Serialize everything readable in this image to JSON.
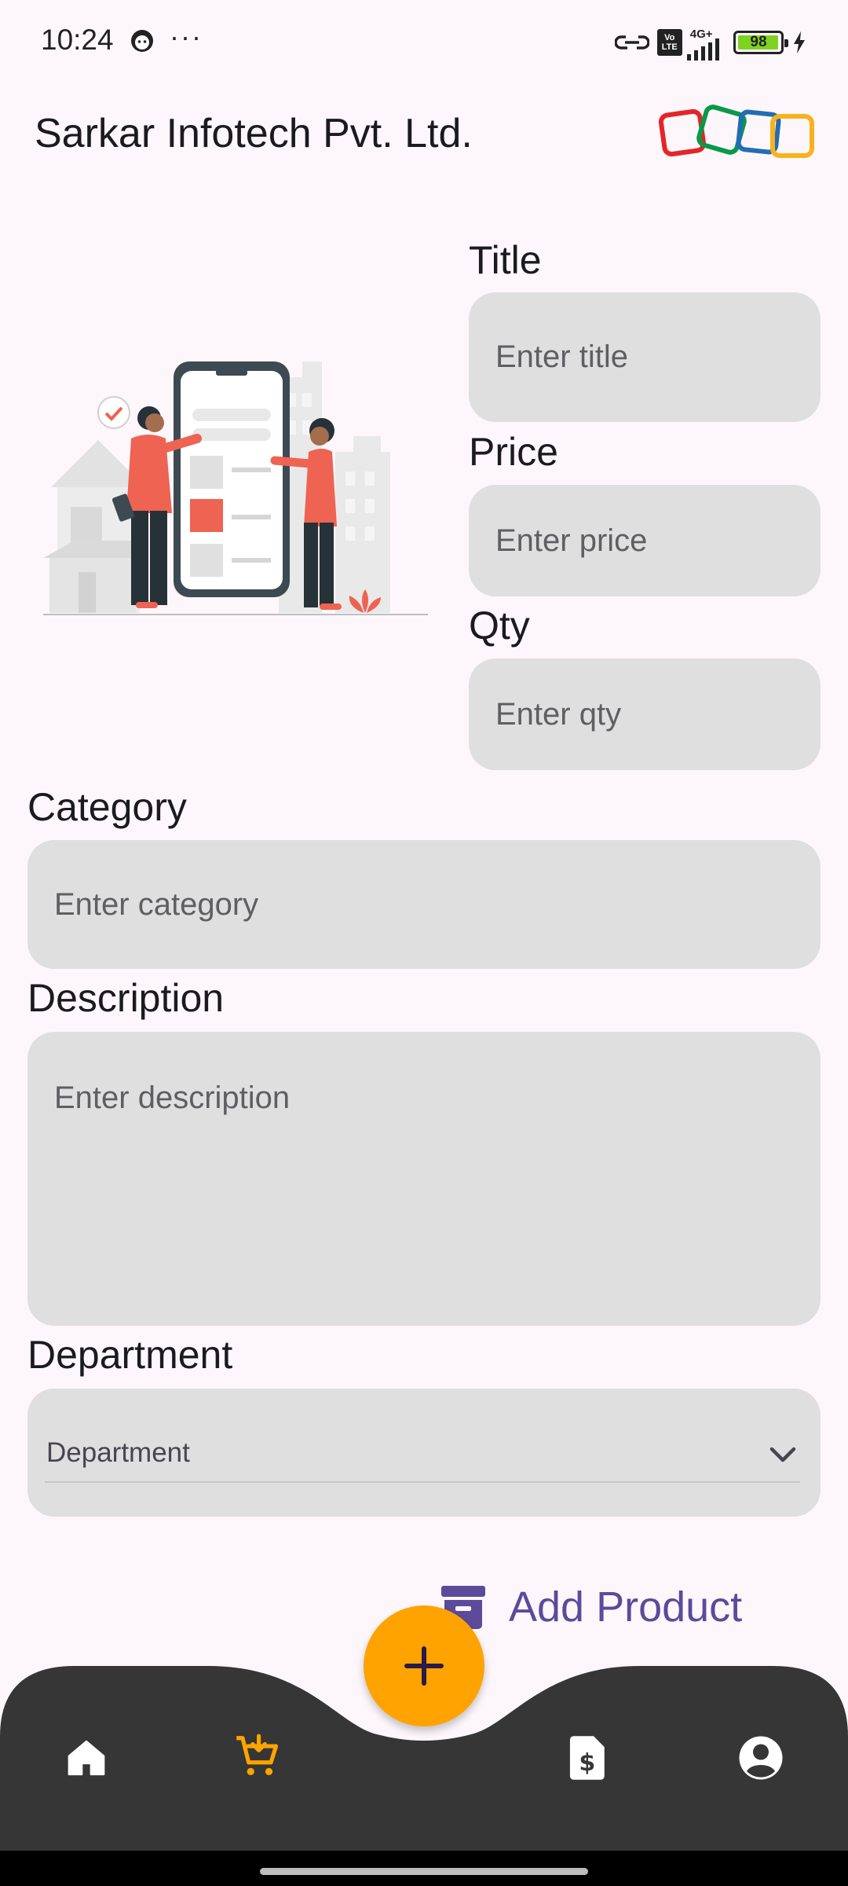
{
  "status_bar": {
    "time": "10:24",
    "more": "···",
    "network_label": "4G+",
    "volte_top": "Vo",
    "volte_bottom": "LTE",
    "battery": "98",
    "battery_level": 0.98,
    "icons": [
      "face-notification-icon",
      "hotspot-link-icon",
      "volte-icon",
      "signal-icon",
      "battery-icon",
      "charging-icon"
    ]
  },
  "header": {
    "title": "Sarkar Infotech Pvt. Ltd.",
    "logo_colors": [
      "#e42527",
      "#089949",
      "#226db4",
      "#f9b21d"
    ]
  },
  "form": {
    "title_label": "Title",
    "title_placeholder": "Enter title",
    "price_label": "Price",
    "price_placeholder": "Enter price",
    "qty_label": "Qty",
    "qty_placeholder": "Enter qty",
    "category_label": "Category",
    "category_placeholder": "Enter category",
    "description_label": "Description",
    "description_placeholder": "Enter description",
    "department_label": "Department",
    "department_select": "Department"
  },
  "actions": {
    "add_product_label": "Add Product"
  },
  "bottom_nav": {
    "items": [
      "home-icon",
      "cart-add-icon",
      "invoice-dollar-icon",
      "account-icon"
    ],
    "active": "cart-add-icon",
    "fab_icon": "plus-icon"
  },
  "colors": {
    "accent": "#ffa300",
    "nav_background": "#353635",
    "field_background": "#e0dfe0",
    "primary_text": "#5b4b9a"
  }
}
